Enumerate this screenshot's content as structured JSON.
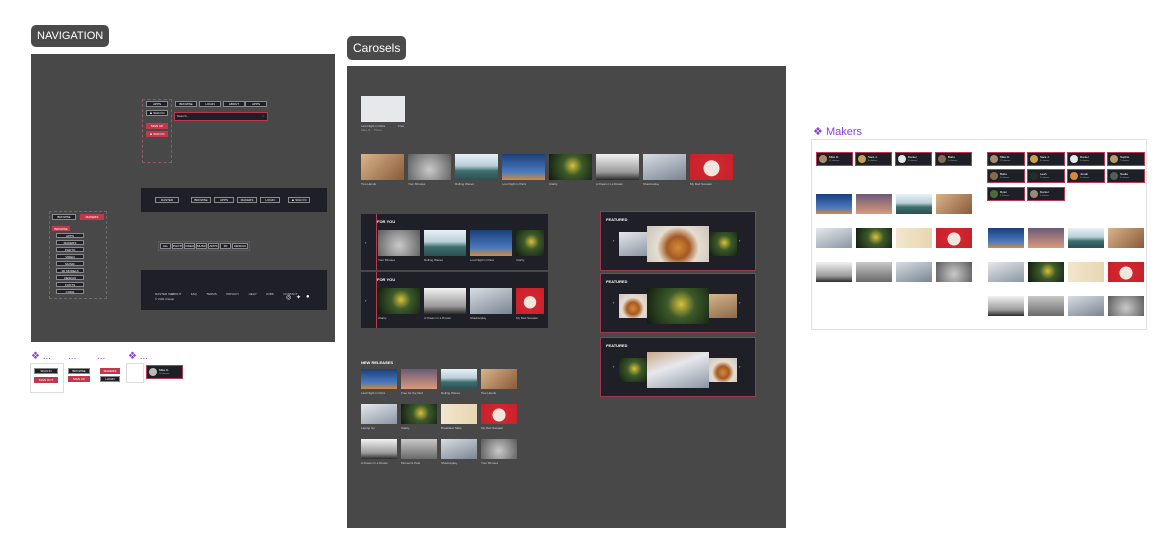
{
  "frames": {
    "navigation_label": "NAVIGATION",
    "carousels_label": "Carosels",
    "makers_label": "Makers",
    "makers_diamond": "❖"
  },
  "nav": {
    "menu_top": [
      "APPS",
      "BROWSE",
      "LOGIN",
      "ABOUT"
    ],
    "search_placeholder": "Search...",
    "sign_in": "SIGN IN",
    "sign_in_2": "SIGN IN",
    "sign_out": "SIGN OUT",
    "sign_up": "SIGN UP",
    "header_bar": {
      "logo": "RASTER",
      "items": [
        "BROWSE",
        "APPS",
        "MAKERS",
        "LOGIN"
      ],
      "user_button": "SIGN IN"
    },
    "filter_chips": [
      "ALL",
      "PHOTO",
      "VIDEO",
      "MUSIC",
      "APPS",
      "3D",
      "DESIGN"
    ],
    "sidebar_tabs": [
      "BROWSE",
      "MAKERS"
    ],
    "sidebar_items": [
      "BROWSE",
      "APPS",
      "MAKERS",
      "PHOTO",
      "VIDEO",
      "MUSIC",
      "3D MODELS",
      "DESIGN",
      "FONTS",
      "CODE"
    ],
    "footer": {
      "links": [
        "ABOUT",
        "FAQ",
        "TERMS",
        "PRIVACY",
        "HELP",
        "JOBS",
        "CONTACT"
      ],
      "copyright": "RASTER INC.",
      "copyright_2": "© 2021 Raster"
    }
  },
  "components": {
    "label_1": "❖ ...",
    "label_2": "...",
    "label_3": "...",
    "label_4": "❖ ...",
    "btn_pairs": [
      [
        "SIGN IN",
        "SIGN OUT"
      ],
      [
        "BROWSE",
        "SIGN UP"
      ],
      [
        "MAKERS",
        "LOGIN"
      ]
    ],
    "maker_card_name": "Mike D.",
    "maker_card_sub": "12 releases"
  },
  "carousels": {
    "single_card": {
      "title": "Last Night in Paris",
      "price": "Free",
      "sub": "Mike D. · Photo"
    },
    "strip": [
      {
        "title": "Two Hands",
        "price": "Free"
      },
      {
        "title": "Your Minutes",
        "price": "$4"
      },
      {
        "title": "Rolling Waves",
        "price": "Free"
      },
      {
        "title": "Lost Night in Paris",
        "price": "$2"
      },
      {
        "title": "Clarity",
        "price": "Free"
      },
      {
        "title": "A Dream in a Dream",
        "price": "$6"
      },
      {
        "title": "Shadowplay",
        "price": "Free"
      },
      {
        "title": "My Red Sweater",
        "price": "$3"
      }
    ],
    "for_you_1": {
      "heading": "FOR YOU",
      "items": [
        "Your Minutes",
        "Rolling Waves",
        "Lost Night in Paris",
        "Clarity"
      ]
    },
    "for_you_2": {
      "heading": "FOR YOU",
      "items": [
        "Clarity",
        "A Dream in a Dream",
        "Shadowplay",
        "My Red Sweater"
      ]
    },
    "featured": [
      "FEATURED",
      "FEATURED",
      "FEATURED"
    ],
    "new_releases": {
      "heading": "NEW RELEASES",
      "items": [
        "Last Night in Paris",
        "Free for the Web",
        "Rolling Waves",
        "Two Hands",
        "Laptop Up",
        "Clarity",
        "Breakfast Table",
        "My Red Sweater",
        "A Dream in a Dream",
        "Moments Past",
        "Shadowplay",
        "Your Minutes"
      ]
    }
  },
  "makers": {
    "left": [
      {
        "name": "Mike D.",
        "sub": "12 releases"
      },
      {
        "name": "Sara J.",
        "sub": "8 releases"
      },
      {
        "name": "Daniel",
        "sub": "5 releases"
      },
      {
        "name": "Babs",
        "sub": "3 releases"
      }
    ],
    "right": [
      {
        "name": "Mike D.",
        "sub": "12 releases"
      },
      {
        "name": "Sara J.",
        "sub": "8 releases"
      },
      {
        "name": "Daniel",
        "sub": "5 releases"
      },
      {
        "name": "Sophie",
        "sub": "7 releases"
      },
      {
        "name": "Babs",
        "sub": "3 releases"
      },
      {
        "name": "Leah",
        "sub": "2 releases"
      },
      {
        "name": "Jonah",
        "sub": "4 releases"
      },
      {
        "name": "Nadia",
        "sub": "6 releases"
      },
      {
        "name": "Ryan",
        "sub": "9 releases"
      },
      {
        "name": "Daniel",
        "sub": "5 releases"
      }
    ]
  },
  "colors": {
    "board": "#484848",
    "panel": "#1e1f27",
    "accent": "#c0394b",
    "outline": "#b83a52"
  }
}
